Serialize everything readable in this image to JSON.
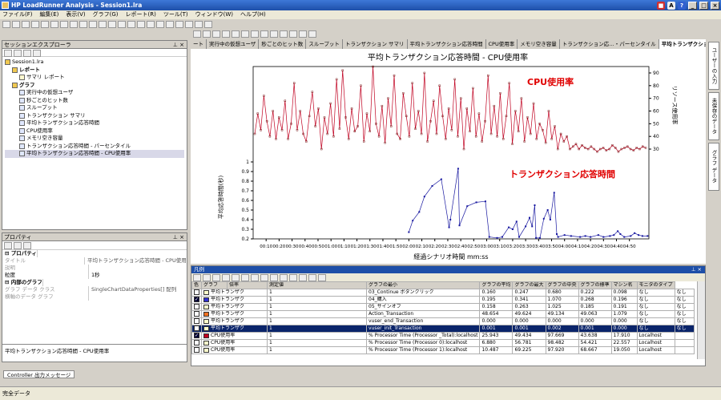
{
  "window": {
    "title": "HP LoadRunner Analysis - Session1.lra"
  },
  "menu": [
    "ファイル(F)",
    "編集(E)",
    "表示(V)",
    "グラフ(G)",
    "レポート(R)",
    "ツール(T)",
    "ウィンドウ(W)",
    "ヘルプ(H)"
  ],
  "explorer": {
    "title": "セッションエクスプローラ",
    "items": [
      {
        "label": "Session1.lra",
        "level": 0,
        "icon": "folder"
      },
      {
        "label": "レポート",
        "level": 1,
        "icon": "folder",
        "bold": true
      },
      {
        "label": "サマリ レポート",
        "level": 2,
        "icon": "doc"
      },
      {
        "label": "グラフ",
        "level": 1,
        "icon": "folder",
        "bold": true
      },
      {
        "label": "実行中の仮想ユーザ",
        "level": 2,
        "icon": "graph"
      },
      {
        "label": "秒ごとのヒット数",
        "level": 2,
        "icon": "graph"
      },
      {
        "label": "スループット",
        "level": 2,
        "icon": "graph"
      },
      {
        "label": "トランザクション サマリ",
        "level": 2,
        "icon": "graph"
      },
      {
        "label": "平均トランザクション応答時間",
        "level": 2,
        "icon": "graph"
      },
      {
        "label": "CPU使用率",
        "level": 2,
        "icon": "graph"
      },
      {
        "label": "メモリ空き容量",
        "level": 2,
        "icon": "graph"
      },
      {
        "label": "トランザクション応答時間 - パーセンタイル",
        "level": 2,
        "icon": "graph"
      },
      {
        "label": "平均トランザクション応答時間 - CPU使用率",
        "level": 2,
        "icon": "graph",
        "selected": true
      }
    ]
  },
  "properties": {
    "title": "プロパティ",
    "section1": "プロパティ",
    "rows": [
      {
        "k": "タイトル",
        "v": "平均トランザクション応答時間 - CPU使用率",
        "dim": true
      },
      {
        "k": "説明",
        "v": "",
        "dim": true
      },
      {
        "k": "粒度",
        "v": "1秒",
        "dim": false
      }
    ],
    "section2": "内部のグラフ",
    "rows2": [
      {
        "k": "グラフ データ クラス",
        "v": "SingleChartDataProperties[] 配列"
      },
      {
        "k": "横軸のデータ グラフ",
        "v": ""
      }
    ],
    "footer": "平均トランザクション応答時間 - CPU使用率"
  },
  "tabs": [
    "ート",
    "実行中の仮想ユーザ",
    "秒ごとのヒット数",
    "スループット",
    "トランザクション サマリ",
    "平均トランザクション応答時間",
    "CPU使用率",
    "メモリ空き容量",
    "トランザクション応…・パーセンタイル",
    "平均トランザクション応答時間 - CPU使用率"
  ],
  "active_tab": 9,
  "chart_data": {
    "type": "line",
    "title": "平均トランザクション応答時間 - CPU使用率",
    "xlabel": "経過シナリオ時間 mm:ss",
    "ylabel_left": "平均応答時間(秒)",
    "ylabel_right": "リソース使用率",
    "annotation_cpu": "CPU使用率",
    "annotation_resp": "トランザクション応答時間",
    "x_ticks": [
      "00:10",
      "00:20",
      "00:30",
      "00:40",
      "00:50",
      "01:00",
      "01:10",
      "01:20",
      "01:30",
      "01:40",
      "01:50",
      "02:00",
      "02:10",
      "02:20",
      "02:30",
      "02:40",
      "02:50",
      "03:00",
      "03:10",
      "03:20",
      "03:30",
      "03:40",
      "03:50",
      "04:00",
      "04:10",
      "04:20",
      "04:30",
      "04:40",
      "04:50"
    ],
    "y_left_ticks": [
      0.2,
      0.3,
      0.4,
      0.5,
      0.6,
      0.7,
      0.8,
      0.9,
      1
    ],
    "y_right_ticks": [
      30,
      40,
      50,
      60,
      70,
      80,
      90
    ],
    "cpu_series": {
      "name": "CPU使用率",
      "x_range": [
        0,
        295
      ],
      "y": [
        42,
        58,
        45,
        72,
        52,
        40,
        60,
        38,
        55,
        45,
        68,
        38,
        50,
        82,
        45,
        60,
        42,
        36,
        56,
        75,
        48,
        62,
        30,
        55,
        42,
        66,
        40,
        85,
        46,
        92,
        55,
        38,
        62,
        44,
        48,
        80,
        36,
        58,
        44,
        95,
        50,
        40,
        64,
        35,
        70,
        48,
        88,
        42,
        38,
        74,
        56,
        40,
        82,
        46,
        60,
        42,
        90,
        36,
        52,
        68,
        42,
        80,
        56,
        38,
        62,
        45,
        85,
        40,
        70,
        30,
        62,
        44,
        78,
        40,
        58,
        36,
        52,
        88,
        42,
        64,
        40,
        74,
        38,
        56,
        82,
        34,
        60,
        44,
        70,
        36,
        55,
        42,
        66,
        38,
        50,
        45,
        35,
        60,
        38,
        48,
        30,
        42,
        36,
        40,
        30,
        32,
        34,
        30,
        33,
        31,
        30,
        32,
        30,
        28,
        30,
        31,
        29,
        30,
        33,
        31,
        28,
        30,
        31,
        32,
        30,
        29,
        31,
        30,
        32,
        31
      ]
    },
    "resp_series": {
      "name": "トランザクション応答時間",
      "points": [
        [
          120,
          0.27
        ],
        [
          123,
          0.39
        ],
        [
          128,
          0.48
        ],
        [
          132,
          0.64
        ],
        [
          138,
          0.75
        ],
        [
          145,
          0.82
        ],
        [
          151,
          0.32
        ],
        [
          152,
          0.4
        ],
        [
          158,
          0.93
        ],
        [
          159,
          0.34
        ],
        [
          165,
          0.54
        ],
        [
          172,
          0.58
        ],
        [
          179,
          0.59
        ],
        [
          182,
          0.22
        ],
        [
          188,
          0.21
        ],
        [
          192,
          0.22
        ],
        [
          197,
          0.32
        ],
        [
          200,
          0.3
        ],
        [
          203,
          0.38
        ],
        [
          205,
          0.22
        ],
        [
          210,
          0.33
        ],
        [
          213,
          0.42
        ],
        [
          215,
          0.33
        ],
        [
          217,
          0.55
        ],
        [
          218,
          0.21
        ],
        [
          221,
          0.21
        ],
        [
          224,
          0.41
        ],
        [
          227,
          0.5
        ],
        [
          229,
          0.4
        ],
        [
          232,
          0.68
        ],
        [
          234,
          0.25
        ],
        [
          235,
          0.22
        ],
        [
          240,
          0.24
        ],
        [
          245,
          0.23
        ],
        [
          252,
          0.22
        ],
        [
          256,
          0.23
        ],
        [
          260,
          0.22
        ],
        [
          266,
          0.24
        ],
        [
          270,
          0.22
        ],
        [
          275,
          0.23
        ],
        [
          278,
          0.24
        ],
        [
          281,
          0.28
        ],
        [
          283,
          0.25
        ],
        [
          286,
          0.22
        ],
        [
          291,
          0.23
        ],
        [
          294,
          0.26
        ],
        [
          297,
          0.24
        ],
        [
          300,
          0.23
        ],
        [
          304,
          0.23
        ]
      ]
    }
  },
  "legend": {
    "title": "凡例",
    "headers": [
      "色",
      "グラフ",
      "倍率",
      "測定値",
      "グラフの最小",
      "グラフの平均",
      "グラフの最大",
      "グラフの中央",
      "グラフの標準",
      "マシン名",
      "モニタのタイプ"
    ],
    "rows": [
      {
        "color": "#ffffcc",
        "checked": false,
        "graph": "平均トランザク",
        "scale": "1",
        "measure": "03_Continue ボタンクリック",
        "min": "0.160",
        "avg": "0.247",
        "max": "0.680",
        "median": "0.222",
        "std": "0.098",
        "machine": "なし",
        "monitor": "なし"
      },
      {
        "color": "#3030d0",
        "checked": true,
        "graph": "平均トランザク",
        "scale": "1",
        "measure": "04_購入",
        "min": "0.195",
        "avg": "0.341",
        "max": "1.070",
        "median": "0.268",
        "std": "0.196",
        "machine": "なし",
        "monitor": "なし"
      },
      {
        "color": "#ffffcc",
        "checked": false,
        "graph": "平均トランザク",
        "scale": "1",
        "measure": "05_サインオフ",
        "min": "0.158",
        "avg": "0.263",
        "max": "1.025",
        "median": "0.185",
        "std": "0.191",
        "machine": "なし",
        "monitor": "なし"
      },
      {
        "color": "#f07020",
        "checked": false,
        "graph": "平均トランザク",
        "scale": "1",
        "measure": "Action_Transaction",
        "min": "48.654",
        "avg": "49.624",
        "max": "49.134",
        "median": "49.063",
        "std": "1.079",
        "machine": "なし",
        "monitor": "なし"
      },
      {
        "color": "#ffffcc",
        "checked": false,
        "graph": "平均トランザク",
        "scale": "1",
        "measure": "vuser_end_Transaction",
        "min": "0.000",
        "avg": "0.000",
        "max": "0.000",
        "median": "0.000",
        "std": "0.000",
        "machine": "なし",
        "monitor": "なし"
      },
      {
        "color": "#ffffcc",
        "checked": false,
        "graph": "平均トランザク",
        "scale": "1",
        "measure": "vuser_init_Transaction",
        "min": "0.001",
        "avg": "0.001",
        "max": "0.002",
        "median": "0.001",
        "std": "0.000",
        "machine": "なし",
        "monitor": "なし",
        "selected": true
      },
      {
        "color": "#c00020",
        "checked": true,
        "graph": "CPU使用率",
        "scale": "1",
        "measure": "% Processor Time (Processor _Total):localhost",
        "min": "25.943",
        "avg": "49.434",
        "max": "97.669",
        "median": "43.638",
        "std": "17.910",
        "machine": "Localhost",
        "monitor": ""
      },
      {
        "color": "#ffffcc",
        "checked": false,
        "graph": "CPU使用率",
        "scale": "1",
        "measure": "% Processor Time (Processor 0):localhost",
        "min": "6.880",
        "avg": "56.781",
        "max": "98.482",
        "median": "54.421",
        "std": "22.557",
        "machine": "Localhost",
        "monitor": ""
      },
      {
        "color": "#ffffcc",
        "checked": false,
        "graph": "CPU使用率",
        "scale": "1",
        "measure": "% Processor Time (Processor 1):localhost",
        "min": "10.487",
        "avg": "69.225",
        "max": "97.920",
        "median": "68.667",
        "std": "19.050",
        "machine": "Localhost",
        "monitor": ""
      }
    ]
  },
  "sidetabs": [
    "ユーザーの入力",
    "未保存のデータ",
    "グラフ データ"
  ],
  "output_tab": "Controller 出力メッセージ",
  "status": "完全データ"
}
